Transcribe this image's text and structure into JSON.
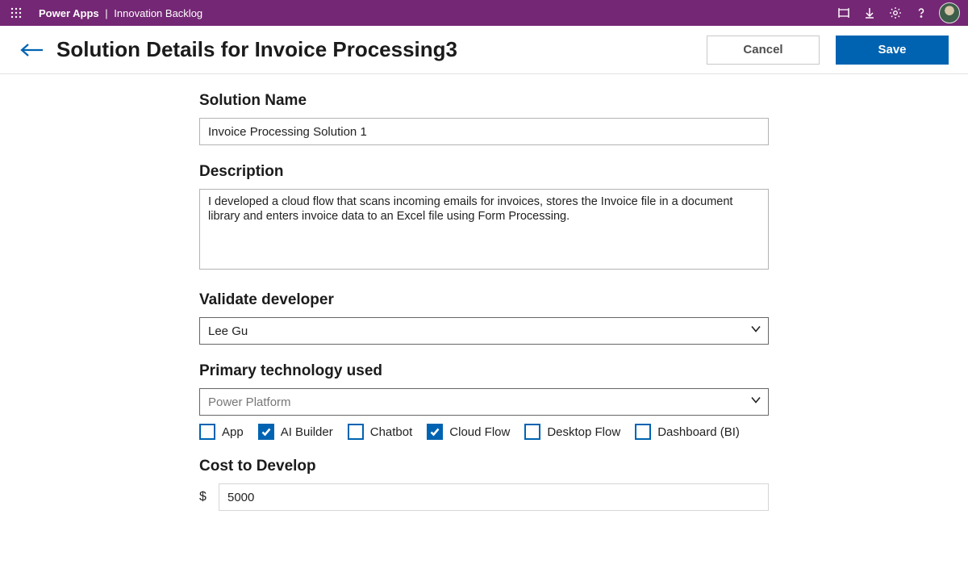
{
  "topbar": {
    "app": "Power Apps",
    "separator": "|",
    "sub": "Innovation Backlog"
  },
  "header": {
    "title": "Solution Details for Invoice Processing3",
    "cancel": "Cancel",
    "save": "Save"
  },
  "form": {
    "solution_name": {
      "label": "Solution Name",
      "value": "Invoice Processing Solution 1"
    },
    "description": {
      "label": "Description",
      "value": "I developed a cloud flow that scans incoming emails for invoices, stores the Invoice file in a document library and enters invoice data to an Excel file using Form Processing."
    },
    "validate_developer": {
      "label": "Validate developer",
      "value": "Lee Gu"
    },
    "primary_tech": {
      "label": "Primary technology used",
      "value": "Power Platform"
    },
    "checkboxes": {
      "app": {
        "label": "App",
        "checked": false
      },
      "ai_builder": {
        "label": "AI Builder",
        "checked": true
      },
      "chatbot": {
        "label": "Chatbot",
        "checked": false
      },
      "cloud_flow": {
        "label": "Cloud Flow",
        "checked": true
      },
      "desktop_flow": {
        "label": "Desktop Flow",
        "checked": false
      },
      "dashboard_bi": {
        "label": "Dashboard (BI)",
        "checked": false
      }
    },
    "cost": {
      "label": "Cost to Develop",
      "currency": "$",
      "value": "5000"
    }
  }
}
